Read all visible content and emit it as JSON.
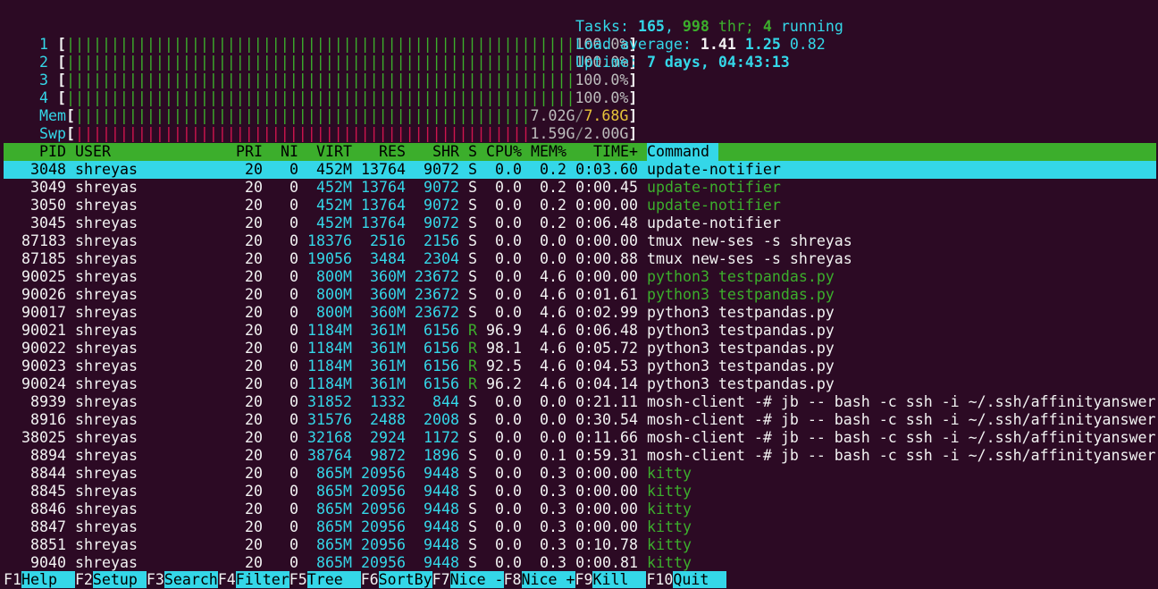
{
  "meters": {
    "cpus": [
      {
        "label": "1",
        "value": "100.0%"
      },
      {
        "label": "2",
        "value": "100.0%"
      },
      {
        "label": "3",
        "value": "100.0%"
      },
      {
        "label": "4",
        "value": "100.0%"
      }
    ],
    "mem": {
      "label": "Mem",
      "used": "7.02G",
      "total": "7.68G"
    },
    "swp": {
      "label": "Swp",
      "used": "1.59G",
      "total": "2.00G"
    }
  },
  "summary": {
    "tasks_label": "Tasks:",
    "tasks": "165",
    "threads": "998",
    "thr_label": "thr;",
    "running": "4",
    "running_label": "running",
    "load_label": "Load average:",
    "load1": "1.41",
    "load5": "1.25",
    "load15": "0.82",
    "uptime_label": "Uptime:",
    "uptime": "7 days, 04:43:13"
  },
  "columns": {
    "pid": "PID",
    "user": "USER",
    "pri": "PRI",
    "ni": "NI",
    "virt": "VIRT",
    "res": "RES",
    "shr": "SHR",
    "s": "S",
    "cpu": "CPU%",
    "mem": "MEM%",
    "time": "TIME+",
    "command": "Command"
  },
  "processes": [
    {
      "pid": "3048",
      "user": "shreyas",
      "pri": "20",
      "ni": "0",
      "virt": "452M",
      "res": "13764",
      "shr": "9072",
      "s": "S",
      "cpu": "0.0",
      "mem": "0.2",
      "time": "0:03.60",
      "command": "update-notifier",
      "thread": false,
      "selected": true
    },
    {
      "pid": "3049",
      "user": "shreyas",
      "pri": "20",
      "ni": "0",
      "virt": "452M",
      "res": "13764",
      "shr": "9072",
      "s": "S",
      "cpu": "0.0",
      "mem": "0.2",
      "time": "0:00.45",
      "command": "update-notifier",
      "thread": true,
      "selected": false
    },
    {
      "pid": "3050",
      "user": "shreyas",
      "pri": "20",
      "ni": "0",
      "virt": "452M",
      "res": "13764",
      "shr": "9072",
      "s": "S",
      "cpu": "0.0",
      "mem": "0.2",
      "time": "0:00.00",
      "command": "update-notifier",
      "thread": true,
      "selected": false
    },
    {
      "pid": "3045",
      "user": "shreyas",
      "pri": "20",
      "ni": "0",
      "virt": "452M",
      "res": "13764",
      "shr": "9072",
      "s": "S",
      "cpu": "0.0",
      "mem": "0.2",
      "time": "0:06.48",
      "command": "update-notifier",
      "thread": false,
      "selected": false
    },
    {
      "pid": "87183",
      "user": "shreyas",
      "pri": "20",
      "ni": "0",
      "virt": "18376",
      "res": "2516",
      "shr": "2156",
      "s": "S",
      "cpu": "0.0",
      "mem": "0.0",
      "time": "0:00.00",
      "command": "tmux new-ses -s shreyas",
      "thread": false,
      "selected": false
    },
    {
      "pid": "87185",
      "user": "shreyas",
      "pri": "20",
      "ni": "0",
      "virt": "19056",
      "res": "3484",
      "shr": "2304",
      "s": "S",
      "cpu": "0.0",
      "mem": "0.0",
      "time": "0:00.88",
      "command": "tmux new-ses -s shreyas",
      "thread": false,
      "selected": false
    },
    {
      "pid": "90025",
      "user": "shreyas",
      "pri": "20",
      "ni": "0",
      "virt": "800M",
      "res": "360M",
      "shr": "23672",
      "s": "S",
      "cpu": "0.0",
      "mem": "4.6",
      "time": "0:00.00",
      "command": "python3 testpandas.py",
      "thread": true,
      "selected": false
    },
    {
      "pid": "90026",
      "user": "shreyas",
      "pri": "20",
      "ni": "0",
      "virt": "800M",
      "res": "360M",
      "shr": "23672",
      "s": "S",
      "cpu": "0.0",
      "mem": "4.6",
      "time": "0:01.61",
      "command": "python3 testpandas.py",
      "thread": true,
      "selected": false
    },
    {
      "pid": "90017",
      "user": "shreyas",
      "pri": "20",
      "ni": "0",
      "virt": "800M",
      "res": "360M",
      "shr": "23672",
      "s": "S",
      "cpu": "0.0",
      "mem": "4.6",
      "time": "0:02.99",
      "command": "python3 testpandas.py",
      "thread": false,
      "selected": false
    },
    {
      "pid": "90021",
      "user": "shreyas",
      "pri": "20",
      "ni": "0",
      "virt": "1184M",
      "res": "361M",
      "shr": "6156",
      "s": "R",
      "cpu": "96.9",
      "mem": "4.6",
      "time": "0:06.48",
      "command": "python3 testpandas.py",
      "thread": false,
      "selected": false
    },
    {
      "pid": "90022",
      "user": "shreyas",
      "pri": "20",
      "ni": "0",
      "virt": "1184M",
      "res": "361M",
      "shr": "6156",
      "s": "R",
      "cpu": "98.1",
      "mem": "4.6",
      "time": "0:05.72",
      "command": "python3 testpandas.py",
      "thread": false,
      "selected": false
    },
    {
      "pid": "90023",
      "user": "shreyas",
      "pri": "20",
      "ni": "0",
      "virt": "1184M",
      "res": "361M",
      "shr": "6156",
      "s": "R",
      "cpu": "92.5",
      "mem": "4.6",
      "time": "0:04.53",
      "command": "python3 testpandas.py",
      "thread": false,
      "selected": false
    },
    {
      "pid": "90024",
      "user": "shreyas",
      "pri": "20",
      "ni": "0",
      "virt": "1184M",
      "res": "361M",
      "shr": "6156",
      "s": "R",
      "cpu": "96.2",
      "mem": "4.6",
      "time": "0:04.14",
      "command": "python3 testpandas.py",
      "thread": false,
      "selected": false
    },
    {
      "pid": "8939",
      "user": "shreyas",
      "pri": "20",
      "ni": "0",
      "virt": "31852",
      "res": "1332",
      "shr": "844",
      "s": "S",
      "cpu": "0.0",
      "mem": "0.0",
      "time": "0:21.11",
      "command": "mosh-client -# jb -- bash -c ssh -i ~/.ssh/affinityanswers.pem u",
      "thread": false,
      "selected": false
    },
    {
      "pid": "8916",
      "user": "shreyas",
      "pri": "20",
      "ni": "0",
      "virt": "31576",
      "res": "2488",
      "shr": "2008",
      "s": "S",
      "cpu": "0.0",
      "mem": "0.0",
      "time": "0:30.54",
      "command": "mosh-client -# jb -- bash -c ssh -i ~/.ssh/affinityanswers.pem u",
      "thread": false,
      "selected": false
    },
    {
      "pid": "38025",
      "user": "shreyas",
      "pri": "20",
      "ni": "0",
      "virt": "32168",
      "res": "2924",
      "shr": "1172",
      "s": "S",
      "cpu": "0.0",
      "mem": "0.0",
      "time": "0:11.66",
      "command": "mosh-client -# jb -- bash -c ssh -i ~/.ssh/affinityanswers.pem c",
      "thread": false,
      "selected": false
    },
    {
      "pid": "8894",
      "user": "shreyas",
      "pri": "20",
      "ni": "0",
      "virt": "38764",
      "res": "9872",
      "shr": "1896",
      "s": "S",
      "cpu": "0.0",
      "mem": "0.1",
      "time": "0:59.31",
      "command": "mosh-client -# jb -- bash -c ssh -i ~/.ssh/affinityanswers.pem c",
      "thread": false,
      "selected": false
    },
    {
      "pid": "8844",
      "user": "shreyas",
      "pri": "20",
      "ni": "0",
      "virt": "865M",
      "res": "20956",
      "shr": "9448",
      "s": "S",
      "cpu": "0.0",
      "mem": "0.3",
      "time": "0:00.00",
      "command": "kitty",
      "thread": true,
      "selected": false
    },
    {
      "pid": "8845",
      "user": "shreyas",
      "pri": "20",
      "ni": "0",
      "virt": "865M",
      "res": "20956",
      "shr": "9448",
      "s": "S",
      "cpu": "0.0",
      "mem": "0.3",
      "time": "0:00.00",
      "command": "kitty",
      "thread": true,
      "selected": false
    },
    {
      "pid": "8846",
      "user": "shreyas",
      "pri": "20",
      "ni": "0",
      "virt": "865M",
      "res": "20956",
      "shr": "9448",
      "s": "S",
      "cpu": "0.0",
      "mem": "0.3",
      "time": "0:00.00",
      "command": "kitty",
      "thread": true,
      "selected": false
    },
    {
      "pid": "8847",
      "user": "shreyas",
      "pri": "20",
      "ni": "0",
      "virt": "865M",
      "res": "20956",
      "shr": "9448",
      "s": "S",
      "cpu": "0.0",
      "mem": "0.3",
      "time": "0:00.00",
      "command": "kitty",
      "thread": true,
      "selected": false
    },
    {
      "pid": "8851",
      "user": "shreyas",
      "pri": "20",
      "ni": "0",
      "virt": "865M",
      "res": "20956",
      "shr": "9448",
      "s": "S",
      "cpu": "0.0",
      "mem": "0.3",
      "time": "0:10.78",
      "command": "kitty",
      "thread": true,
      "selected": false
    },
    {
      "pid": "9040",
      "user": "shreyas",
      "pri": "20",
      "ni": "0",
      "virt": "865M",
      "res": "20956",
      "shr": "9448",
      "s": "S",
      "cpu": "0.0",
      "mem": "0.3",
      "time": "0:00.81",
      "command": "kitty",
      "thread": true,
      "selected": false
    }
  ],
  "function_keys": [
    {
      "key": "F1",
      "label": "Help  "
    },
    {
      "key": "F2",
      "label": "Setup "
    },
    {
      "key": "F3",
      "label": "Search"
    },
    {
      "key": "F4",
      "label": "Filter"
    },
    {
      "key": "F5",
      "label": "Tree  "
    },
    {
      "key": "F6",
      "label": "SortBy"
    },
    {
      "key": "F7",
      "label": "Nice -"
    },
    {
      "key": "F8",
      "label": "Nice +"
    },
    {
      "key": "F9",
      "label": "Kill  "
    },
    {
      "key": "F10",
      "label": "Quit  "
    }
  ],
  "colors": {
    "background": "#2c0a24",
    "header_bg": "#3cae2c",
    "selection_bg": "#34d7e8",
    "cyan": "#34d7e8",
    "green": "#3cae2c",
    "red": "#d0154e",
    "yellow": "#e7c43a"
  }
}
